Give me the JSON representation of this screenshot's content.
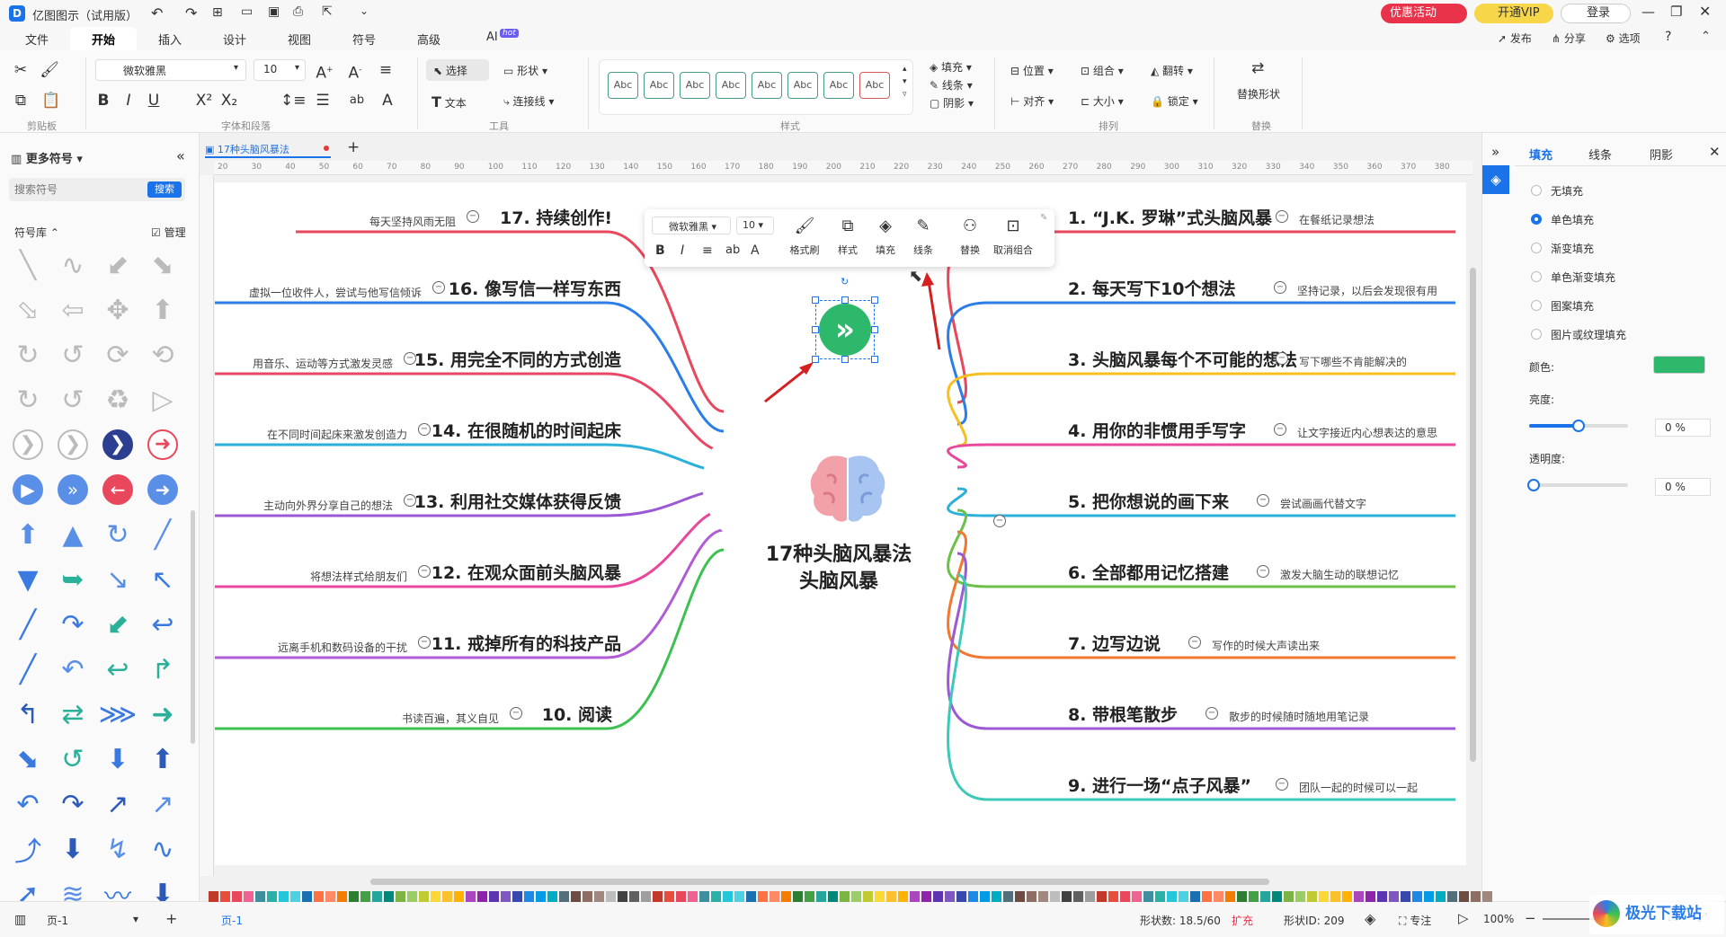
{
  "app": {
    "title": "亿图图示（试用版）",
    "promo": "优惠活动",
    "vip": "开通VIP",
    "login": "登录"
  },
  "menu": {
    "items": [
      "文件",
      "开始",
      "插入",
      "设计",
      "视图",
      "符号",
      "高级",
      "AI"
    ],
    "ai_badge": "hot",
    "right": [
      "发布",
      "分享",
      "选项"
    ]
  },
  "ribbon": {
    "font_name": "微软雅黑",
    "font_size": "10",
    "select": "选择",
    "shape": "形状",
    "text": "文本",
    "connector": "连接线",
    "style_sample": "Abc",
    "fill": "填充",
    "line": "线条",
    "shadow": "阴影",
    "position": "位置",
    "group": "组合",
    "flip": "翻转",
    "align": "对齐",
    "size": "大小",
    "lock": "锁定",
    "replace_shape": "替换形状",
    "groups": [
      "剪贴板",
      "字体和段落",
      "工具",
      "样式",
      "排列",
      "替换"
    ]
  },
  "left": {
    "title": "更多符号",
    "search_placeholder": "搜索符号",
    "search_btn": "搜索",
    "library": "符号库",
    "manage": "管理"
  },
  "doc": {
    "tab": "17种头脑风暴法",
    "ruler": [
      "20",
      "30",
      "40",
      "50",
      "60",
      "70",
      "80",
      "90",
      "100",
      "110",
      "120",
      "130",
      "140",
      "150",
      "160",
      "170",
      "180",
      "190",
      "200",
      "210",
      "220",
      "230",
      "240",
      "250",
      "260",
      "270",
      "280",
      "290",
      "300",
      "310",
      "320",
      "330",
      "340",
      "350",
      "360",
      "370",
      "380"
    ]
  },
  "mindmap": {
    "center": [
      "17种头脑风暴法",
      "头脑风暴"
    ],
    "right": [
      {
        "title": "1. “J.K. 罗琳”式头脑风暴",
        "note": "在餐纸记录想法",
        "color": "#e8475c"
      },
      {
        "title": "2. 每天写下10个想法",
        "note": "坚持记录，以后会发现很有用",
        "color": "#2b7de9"
      },
      {
        "title": "3. 头脑风暴每个不可能的想法",
        "note": "写下哪些不肯能解决的",
        "color": "#f5c020"
      },
      {
        "title": "4. 用你的非惯用手写字",
        "note": "让文字接近内心想表达的意思",
        "color": "#e8479c"
      },
      {
        "title": "5. 把你想说的画下来",
        "note": "尝试画画代替文字",
        "color": "#2bb0d9"
      },
      {
        "title": "6. 全部都用记忆搭建",
        "note": "激发大脑生动的联想记忆",
        "color": "#6cc04a"
      },
      {
        "title": "7. 边写边说",
        "note": "写作的时候大声读出来",
        "color": "#f07830"
      },
      {
        "title": "8. 带根笔散步",
        "note": "散步的时候随时随地用笔记录",
        "color": "#9b59d6"
      },
      {
        "title": "9. 进行一场“点子风暴”",
        "note": "团队一起的时候可以一起",
        "color": "#3cc9b8"
      }
    ],
    "left": [
      {
        "title": "17. 持续创作!",
        "note": "每天坚持风雨无阻",
        "color": "#e8475c"
      },
      {
        "title": "16. 像写信一样写东西",
        "note": "虚拟一位收件人，尝试与他写信倾诉",
        "color": "#2b7de9"
      },
      {
        "title": "15. 用完全不同的方式创造",
        "note": "用音乐、运动等方式激发灵感",
        "color": "#e84766"
      },
      {
        "title": "14. 在很随机的时间起床",
        "note": "在不同时间起床来激发创造力",
        "color": "#2bb0d9"
      },
      {
        "title": "13. 利用社交媒体获得反馈",
        "note": "主动向外界分享自己的想法",
        "color": "#9b59d6"
      },
      {
        "title": "12. 在观众面前头脑风暴",
        "note": "将想法样式给朋友们",
        "color": "#e8479c"
      },
      {
        "title": "11. 戒掉所有的科技产品",
        "note": "远离手机和数码设备的干扰",
        "color": "#b05cd6"
      },
      {
        "title": "10. 阅读",
        "note": "书读百遍，其义自见",
        "color": "#3cc050"
      }
    ]
  },
  "floatbar": {
    "font": "微软雅黑",
    "size": "10",
    "tools": [
      "格式刷",
      "样式",
      "填充",
      "线条",
      "替换",
      "取消组合"
    ]
  },
  "right": {
    "tabs": [
      "填充",
      "线条",
      "阴影"
    ],
    "options": [
      "无填充",
      "单色填充",
      "渐变填充",
      "单色渐变填充",
      "图案填充",
      "图片或纹理填充"
    ],
    "selected": 1,
    "color_label": "颜色:",
    "color": "#2db86b",
    "brightness_label": "亮度:",
    "brightness": "0 %",
    "transparency_label": "透明度:",
    "transparency": "0 %"
  },
  "status": {
    "page_select": "页-1",
    "page_tab": "页-1",
    "shape_count_label": "形状数:",
    "shape_count": "18.5/60",
    "expand": "扩充",
    "shape_id": "形状ID: 209",
    "focus": "专注",
    "zoom": "100%"
  },
  "watermark": "极光下载站"
}
